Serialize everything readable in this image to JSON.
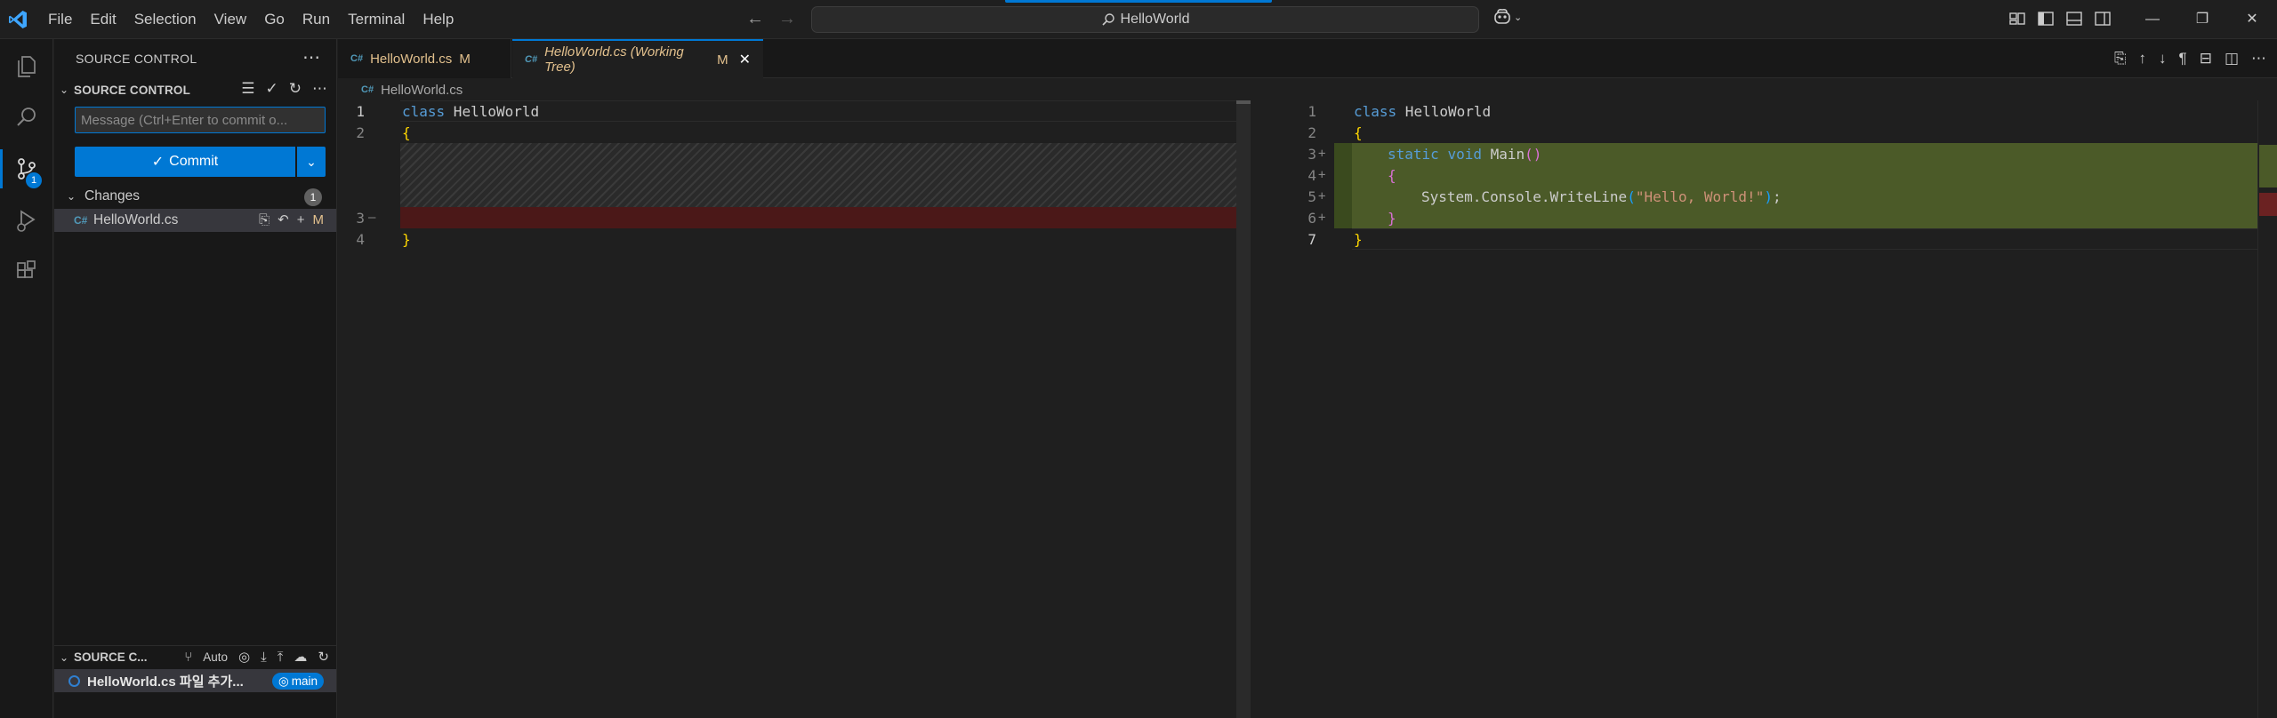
{
  "titlebar": {
    "menu": [
      "File",
      "Edit",
      "Selection",
      "View",
      "Go",
      "Run",
      "Terminal",
      "Help"
    ],
    "search_text": "HelloWorld",
    "window_controls": [
      "—",
      "❐",
      "✕"
    ]
  },
  "activity": {
    "items": [
      "explorer-icon",
      "search-icon",
      "source-control-icon",
      "run-debug-icon",
      "extensions-icon"
    ],
    "source_control_badge": "1"
  },
  "sidebar": {
    "title": "SOURCE CONTROL",
    "section_label": "SOURCE CONTROL",
    "message_placeholder": "Message (Ctrl+Enter to commit o...",
    "commit_label": "Commit",
    "changes_label": "Changes",
    "changes_count": "1",
    "file_name": "HelloWorld.cs",
    "file_status": "M",
    "graph_label": "SOURCE C...",
    "graph_auto": "Auto",
    "graph_item": "HelloWorld.cs 파일 추가...",
    "branch": "main"
  },
  "tabs": [
    {
      "label": "HelloWorld.cs",
      "status": "M"
    },
    {
      "label": "HelloWorld.cs (Working Tree)",
      "status": "M"
    }
  ],
  "breadcrumb": "HelloWorld.cs",
  "left_editor": {
    "lines": [
      {
        "num": "1",
        "kw": "class",
        "rest": " HelloWorld"
      },
      {
        "num": "2",
        "text": "{"
      },
      {
        "num": "3",
        "marker": "—"
      },
      {
        "num": "4",
        "text": "}"
      }
    ]
  },
  "right_editor": {
    "line_numbers": [
      "1",
      "2",
      "3",
      "4",
      "5",
      "6",
      "7"
    ],
    "markers": [
      "+",
      "+",
      "+",
      "+"
    ],
    "class_kw": "class",
    "class_name": " HelloWorld",
    "open_brace": "{",
    "static_kw": "static",
    "void_kw": "void",
    "main_name": " Main",
    "parens": "()",
    "inner_open": "{",
    "console_call": "System.Console.WriteLine",
    "paren_open": "(",
    "string_lit": "\"Hello, World!\"",
    "paren_close": ")",
    "semicolon": ";",
    "inner_close": "}",
    "close_brace": "}"
  },
  "colors": {
    "accent": "#0078d4",
    "modified": "#e2c08d",
    "added_bg": "#4b5a28",
    "removed_bg": "#4b1818"
  }
}
